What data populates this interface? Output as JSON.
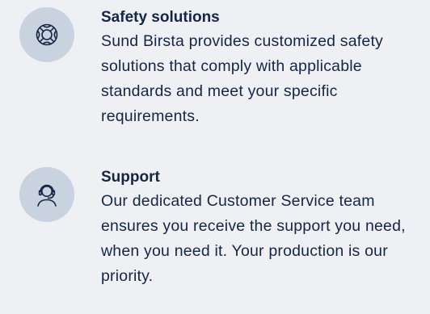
{
  "features": [
    {
      "icon": "lifebuoy-icon",
      "title": "Safety solutions",
      "description": "Sund Birsta provides customized safety solutions that comply with applicable standards and meet your specific requirements."
    },
    {
      "icon": "headset-support-icon",
      "title": "Support",
      "description": "Our dedicated Customer Service team ensures you receive the support you need, when you need it. Your production is our priority."
    }
  ],
  "colors": {
    "background": "#eef0f4",
    "icon_badge": "#c9d2df",
    "text": "#172544"
  }
}
